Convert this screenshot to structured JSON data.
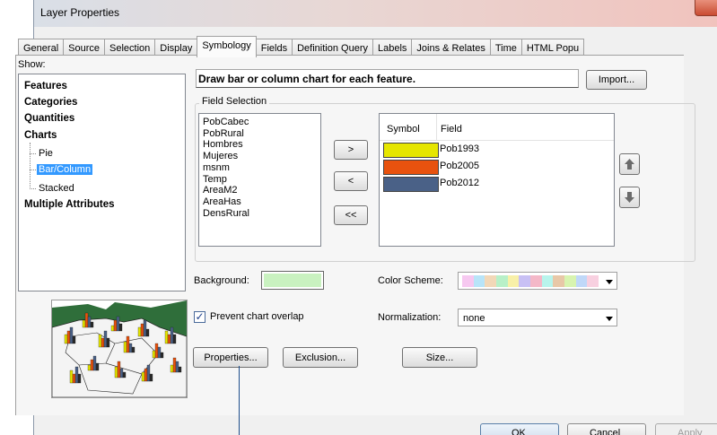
{
  "window": {
    "title": "Layer Properties"
  },
  "tabs": [
    {
      "label": "General"
    },
    {
      "label": "Source"
    },
    {
      "label": "Selection"
    },
    {
      "label": "Display"
    },
    {
      "label": "Symbology",
      "active": true
    },
    {
      "label": "Fields"
    },
    {
      "label": "Definition Query"
    },
    {
      "label": "Labels"
    },
    {
      "label": "Joins & Relates"
    },
    {
      "label": "Time"
    },
    {
      "label": "HTML Popu"
    }
  ],
  "show": {
    "label": "Show:",
    "items": {
      "features": "Features",
      "categories": "Categories",
      "quantities": "Quantities",
      "charts": "Charts",
      "pie": "Pie",
      "bar_column": "Bar/Column",
      "stacked": "Stacked",
      "multiple": "Multiple Attributes"
    },
    "selected": "Bar/Column"
  },
  "header": {
    "text": "Draw bar or column chart for each feature.",
    "import_label": "Import..."
  },
  "field_selection": {
    "title": "Field Selection",
    "available": [
      "PobCabec",
      "PobRural",
      "Hombres",
      "Mujeres",
      "msnm",
      "Temp",
      "AreaM2",
      "AreaHas",
      "DensRural"
    ],
    "move_right": ">",
    "move_left": "<",
    "move_all_left": "<<",
    "table_headers": {
      "symbol": "Symbol",
      "field": "Field"
    },
    "selected_fields": [
      {
        "field": "Pob1993",
        "color": "#e6e600"
      },
      {
        "field": "Pob2005",
        "color": "#e8520e"
      },
      {
        "field": "Pob2012",
        "color": "#4a6187"
      }
    ],
    "up_icon": "arrow-up-icon",
    "down_icon": "arrow-down-icon"
  },
  "background": {
    "label": "Background:",
    "color": "#c9f2c0"
  },
  "color_scheme": {
    "label": "Color  Scheme:",
    "colors": [
      "#f6c8f0",
      "#b8e4f8",
      "#f2d8b8",
      "#b8f0c8",
      "#f8f0a8",
      "#c8c0f4",
      "#f4b8c8",
      "#b8f4ec",
      "#e8c8a8",
      "#d8f4b0",
      "#c0d8f8",
      "#f8d0e0"
    ]
  },
  "prevent_overlap": {
    "label": "Prevent chart overlap",
    "checked": true,
    "check_mark": "✓"
  },
  "normalization": {
    "label": "Normalization:",
    "value": "none"
  },
  "buttons": {
    "properties": "Properties...",
    "exclusion": "Exclusion...",
    "size": "Size..."
  },
  "footer": {
    "ok": "OK",
    "cancel": "Cancel",
    "apply": "Apply"
  }
}
